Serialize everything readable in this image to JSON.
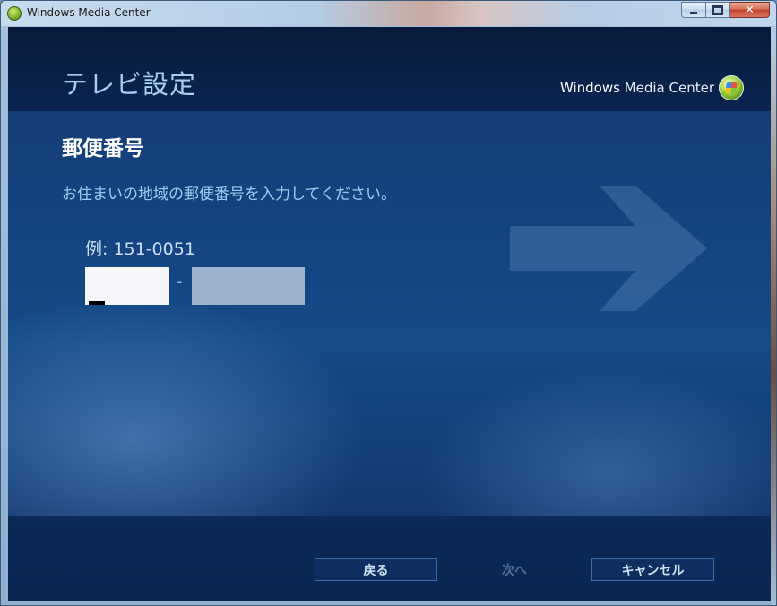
{
  "window": {
    "title": "Windows Media Center",
    "controls": {
      "minimize": "minimize",
      "maximize": "maximize",
      "close": "✕"
    }
  },
  "header": {
    "page_title": "テレビ設定",
    "brand_prefix": "Windows",
    "brand_suffix": " Media Center"
  },
  "content": {
    "section_title": "郵便番号",
    "instruction": "お住まいの地域の郵便番号を入力してください。",
    "example": "例: 151-0051",
    "zip_part1_value": "",
    "zip_separator": "-",
    "zip_part2_value": ""
  },
  "footer": {
    "back_label": "戻る",
    "next_label": "次へ",
    "cancel_label": "キャンセル"
  },
  "colors": {
    "accent_text": "#a8cdf0",
    "background": "#164a89",
    "disabled_text": "#4f6f98"
  }
}
